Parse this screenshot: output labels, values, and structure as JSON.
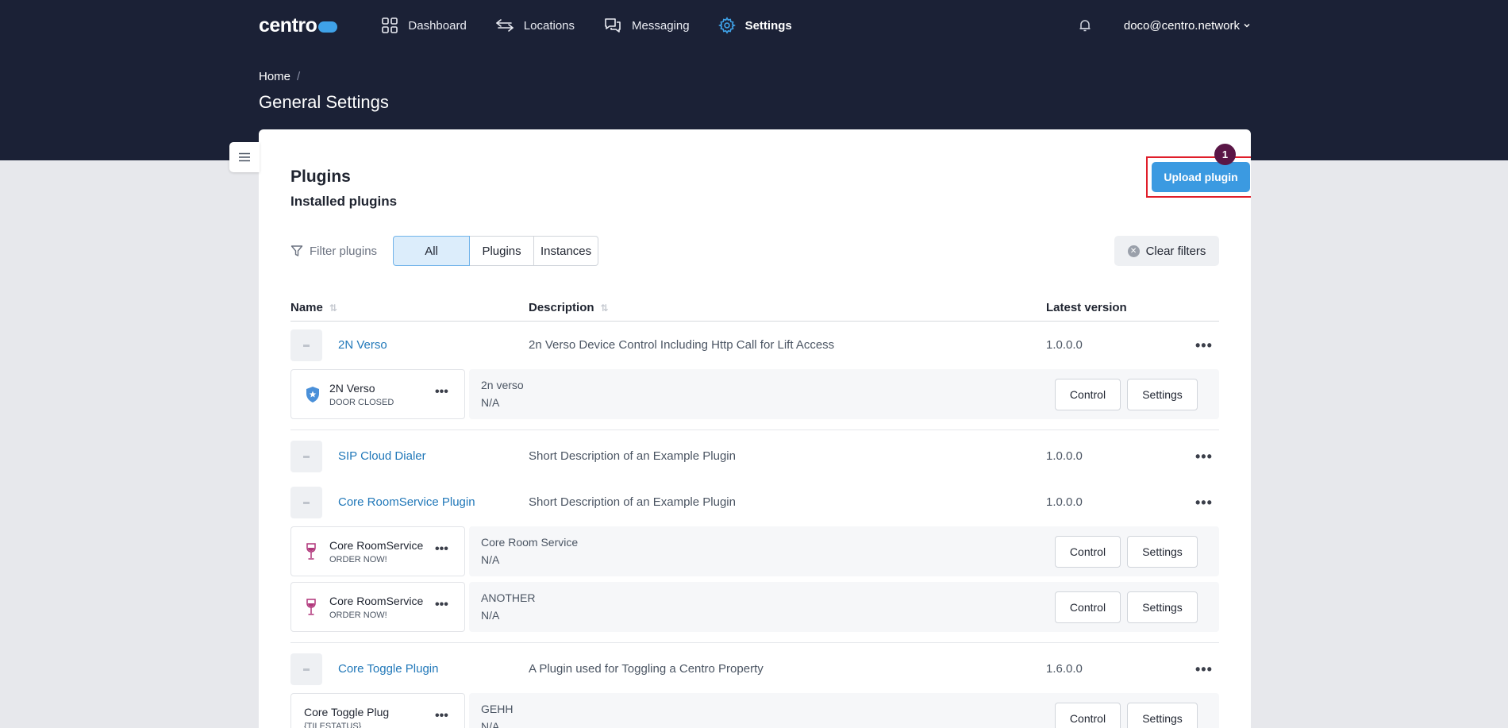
{
  "nav": {
    "logo": "centro",
    "items": [
      {
        "label": "Dashboard",
        "icon": "dashboard-grid-icon"
      },
      {
        "label": "Locations",
        "icon": "arrows-exchange-icon"
      },
      {
        "label": "Messaging",
        "icon": "chat-bubbles-icon"
      },
      {
        "label": "Settings",
        "icon": "gear-icon",
        "active": true
      }
    ],
    "user": "doco@centro.network"
  },
  "breadcrumb": {
    "home": "Home",
    "separator": "/"
  },
  "page_title": "General Settings",
  "plugins": {
    "title": "Plugins",
    "subtitle": "Installed plugins",
    "upload_label": "Upload plugin",
    "badge": "1",
    "filter_label": "Filter plugins",
    "filters": [
      "All",
      "Plugins",
      "Instances"
    ],
    "clear_label": "Clear filters",
    "columns": {
      "name": "Name",
      "description": "Description",
      "version": "Latest version"
    },
    "rows": [
      {
        "name": "2N Verso",
        "description": "2n Verso Device Control Including Http Call for Lift Access",
        "version": "1.0.0.0"
      },
      {
        "name": "SIP Cloud Dialer",
        "description": "Short Description of an Example Plugin",
        "version": "1.0.0.0"
      },
      {
        "name": "Core RoomService Plugin",
        "description": "Short Description of an Example Plugin",
        "version": "1.0.0.0"
      },
      {
        "name": "Core Toggle Plugin",
        "description": "A Plugin used for Toggling a Centro Property",
        "version": "1.6.0.0"
      }
    ],
    "instances": [
      {
        "title": "2N Verso",
        "status": "DOOR CLOSED",
        "line1": "2n verso",
        "line2": "N/A",
        "icon": "shield-star-icon"
      },
      {
        "title": "Core RoomService",
        "status": "ORDER NOW!",
        "line1": "Core Room Service",
        "line2": "N/A",
        "icon": "wine-glass-icon"
      },
      {
        "title": "Core RoomService",
        "status": "ORDER NOW!",
        "line1": "ANOTHER",
        "line2": "N/A",
        "icon": "wine-glass-icon"
      },
      {
        "title": "Core Toggle Plug",
        "status": "{TILESTATUS}",
        "line1": "GEHH",
        "line2": "N/A",
        "icon": ""
      }
    ],
    "control_label": "Control",
    "settings_label": "Settings"
  },
  "colors": {
    "header": "#1b2136",
    "accent": "#3b9ae1",
    "link": "#2178b9",
    "highlight": "#e01e2a",
    "badge": "#5a1646"
  }
}
